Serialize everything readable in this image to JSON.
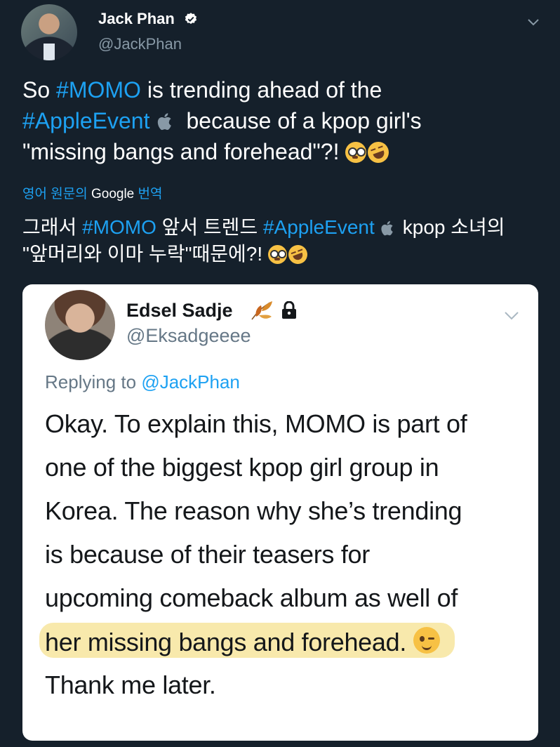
{
  "author": {
    "name": "Jack Phan",
    "handle": "@JackPhan"
  },
  "tweet": {
    "line1_a": "So ",
    "line1_tag": "#MOMO",
    "line1_b": " is trending ahead of the",
    "line2_tag": "#AppleEvent",
    "line2_b": "because of a kpop girl's",
    "line3": "\"missing bangs and forehead\"?! "
  },
  "translation": {
    "label_a": "영어 원문의 ",
    "label_google": "Google",
    "label_b": " 번역",
    "kr1_a": "그래서 ",
    "kr1_tag1": "#MOMO",
    "kr1_b": " 앞서 트렌드 ",
    "kr1_tag2": "#AppleEvent",
    "kr1_c": "kpop 소녀의",
    "kr2": "\"앞머리와 이마 누락\"때문에?! "
  },
  "quoted": {
    "name": "Edsel Sadje",
    "handle": "@Eksadgeeee",
    "replying_label": "Replying to ",
    "replying_mention": "@JackPhan",
    "lines": [
      "Okay. To explain this, MOMO is part of",
      "one of the biggest kpop girl group in",
      "Korea. The reason why she’s trending",
      "is because of their teasers for",
      "upcoming comeback album as well of",
      "her missing bangs and forehead.",
      "Thank me later."
    ]
  },
  "colors": {
    "background": "#15202b",
    "accent": "#1da1f2",
    "secondary": "#8899a6",
    "highlight": "#f8e8a8"
  },
  "icons": [
    "verified-icon",
    "chevron-down-icon",
    "apple-icon",
    "flushed-emoji-icon",
    "laughing-emoji-icon",
    "leaves-icon",
    "lock-icon",
    "wink-emoji-icon"
  ]
}
